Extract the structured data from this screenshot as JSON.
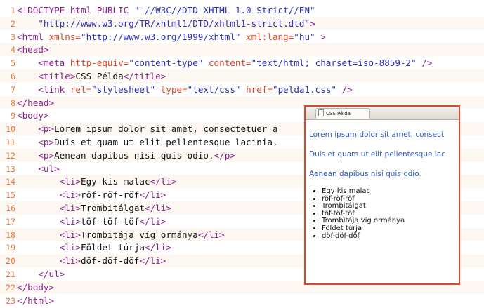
{
  "code_lines": [
    {
      "num": "1",
      "segs": [
        {
          "c": "tag",
          "t": "<!DOCTYPE html PUBLIC "
        },
        {
          "c": "val",
          "t": "\"-//W3C//DTD XHTML 1.0 Strict//EN\""
        }
      ]
    },
    {
      "num": "2",
      "segs": [
        {
          "c": "val",
          "t": "    \"http://www.w3.org/TR/xhtml1/DTD/xhtml1-strict.dtd\""
        },
        {
          "c": "tag",
          "t": ">"
        }
      ]
    },
    {
      "num": "3",
      "segs": [
        {
          "c": "tag",
          "t": "<html "
        },
        {
          "c": "attr",
          "t": "xmlns="
        },
        {
          "c": "val",
          "t": "\"http://www.w3.org/1999/xhtml\" "
        },
        {
          "c": "attr",
          "t": "xml:lang="
        },
        {
          "c": "val",
          "t": "\"hu\""
        },
        {
          "c": "tag",
          "t": " >"
        }
      ]
    },
    {
      "num": "4",
      "segs": [
        {
          "c": "tag",
          "t": "<head>"
        }
      ]
    },
    {
      "num": "5",
      "segs": [
        {
          "c": "tag",
          "t": "    <meta "
        },
        {
          "c": "attr",
          "t": "http-equiv="
        },
        {
          "c": "val",
          "t": "\"content-type\" "
        },
        {
          "c": "attr",
          "t": "content="
        },
        {
          "c": "val",
          "t": "\"text/html; charset=iso-8859-2\""
        },
        {
          "c": "tag",
          "t": " />"
        }
      ]
    },
    {
      "num": "6",
      "segs": [
        {
          "c": "tag",
          "t": "    <title>"
        },
        {
          "c": "text",
          "t": "CSS Példa"
        },
        {
          "c": "tag",
          "t": "</title>"
        }
      ]
    },
    {
      "num": "7",
      "segs": [
        {
          "c": "tag",
          "t": "    <link "
        },
        {
          "c": "attr",
          "t": "rel="
        },
        {
          "c": "val",
          "t": "\"stylesheet\" "
        },
        {
          "c": "attr",
          "t": "type="
        },
        {
          "c": "val",
          "t": "\"text/css\" "
        },
        {
          "c": "attr",
          "t": "href="
        },
        {
          "c": "val",
          "t": "\"pelda1.css\""
        },
        {
          "c": "tag",
          "t": " />"
        }
      ]
    },
    {
      "num": "8",
      "segs": [
        {
          "c": "tag",
          "t": "</head>"
        }
      ]
    },
    {
      "num": "9",
      "segs": [
        {
          "c": "tag",
          "t": "<body>"
        }
      ]
    },
    {
      "num": "10",
      "segs": [
        {
          "c": "tag",
          "t": "    <p>"
        },
        {
          "c": "text",
          "t": "Lorem ipsum dolor sit amet, consectetuer a"
        }
      ]
    },
    {
      "num": "11",
      "segs": [
        {
          "c": "tag",
          "t": "    <p>"
        },
        {
          "c": "text",
          "t": "Duis et quam ut elit pellentesque lacinia."
        }
      ]
    },
    {
      "num": "12",
      "segs": [
        {
          "c": "tag",
          "t": "    <p>"
        },
        {
          "c": "text",
          "t": "Aenean dapibus nisi quis odio."
        },
        {
          "c": "tag",
          "t": "</p>"
        }
      ]
    },
    {
      "num": "13",
      "segs": [
        {
          "c": "tag",
          "t": "    <ul>"
        }
      ]
    },
    {
      "num": "14",
      "segs": [
        {
          "c": "tag",
          "t": "        <li>"
        },
        {
          "c": "text",
          "t": "Egy kis malac"
        },
        {
          "c": "tag",
          "t": "</li>"
        }
      ]
    },
    {
      "num": "15",
      "segs": [
        {
          "c": "tag",
          "t": "        <li>"
        },
        {
          "c": "text",
          "t": "röf-röf-röf"
        },
        {
          "c": "tag",
          "t": "</li>"
        }
      ]
    },
    {
      "num": "16",
      "segs": [
        {
          "c": "tag",
          "t": "        <li>"
        },
        {
          "c": "text",
          "t": "Trombitálgat"
        },
        {
          "c": "tag",
          "t": "</li>"
        }
      ]
    },
    {
      "num": "17",
      "segs": [
        {
          "c": "tag",
          "t": "        <li>"
        },
        {
          "c": "text",
          "t": "töf-töf-töf"
        },
        {
          "c": "tag",
          "t": "</li>"
        }
      ]
    },
    {
      "num": "18",
      "segs": [
        {
          "c": "tag",
          "t": "        <li>"
        },
        {
          "c": "text",
          "t": "Trombitája víg ormánya"
        },
        {
          "c": "tag",
          "t": "</li>"
        }
      ]
    },
    {
      "num": "19",
      "segs": [
        {
          "c": "tag",
          "t": "        <li>"
        },
        {
          "c": "text",
          "t": "Földet túrja"
        },
        {
          "c": "tag",
          "t": "</li>"
        }
      ]
    },
    {
      "num": "20",
      "segs": [
        {
          "c": "tag",
          "t": "        <li>"
        },
        {
          "c": "text",
          "t": "döf-döf-döf"
        },
        {
          "c": "tag",
          "t": "</li>"
        }
      ]
    },
    {
      "num": "21",
      "segs": [
        {
          "c": "tag",
          "t": "    </ul>"
        }
      ]
    },
    {
      "num": "22",
      "segs": [
        {
          "c": "tag",
          "t": "</body>"
        }
      ]
    },
    {
      "num": "23",
      "segs": [
        {
          "c": "tag",
          "t": "</html>"
        }
      ]
    }
  ],
  "preview": {
    "tab_title": "CSS Példa",
    "tab_icon": "page-icon",
    "paragraphs": [
      "Lorem ipsum dolor sit amet, consect",
      "Duis et quam ut elit pellentesque lac",
      "Aenean dapibus nisi quis odio."
    ],
    "list_items": [
      "Egy kis malac",
      "röf-röf-röf",
      "Trombitálgat",
      "töf-töf-töf",
      "Trombitája víg ormánya",
      "Földet túrja",
      "döf-döf-döf"
    ],
    "border_color": "#d9472b",
    "text_color": "#2e5ec9"
  }
}
